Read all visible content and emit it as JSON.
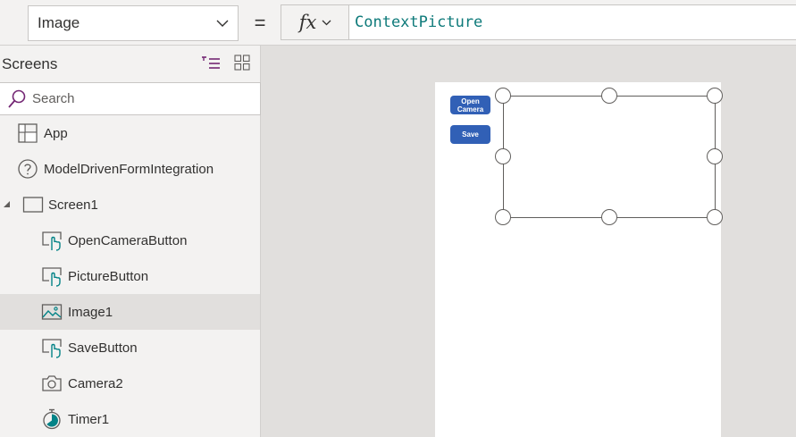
{
  "formula_bar": {
    "property": "Image",
    "equals": "=",
    "fx_label": "fx",
    "formula": "ContextPicture"
  },
  "tree_view": {
    "title": "Screens",
    "search_placeholder": "Search",
    "items": [
      {
        "label": "App",
        "icon": "app-icon",
        "level": 0
      },
      {
        "label": "ModelDrivenFormIntegration",
        "icon": "question-circle-icon",
        "level": 0
      },
      {
        "label": "Screen1",
        "icon": "screen-icon",
        "level": 1,
        "expanded": true
      },
      {
        "label": "OpenCameraButton",
        "icon": "button-control-icon",
        "level": 2
      },
      {
        "label": "PictureButton",
        "icon": "button-control-icon",
        "level": 2
      },
      {
        "label": "Image1",
        "icon": "image-control-icon",
        "level": 2,
        "selected": true
      },
      {
        "label": "SaveButton",
        "icon": "button-control-icon",
        "level": 2
      },
      {
        "label": "Camera2",
        "icon": "camera-icon",
        "level": 2
      },
      {
        "label": "Timer1",
        "icon": "timer-icon",
        "level": 2
      }
    ]
  },
  "canvas": {
    "open_camera_label": "Open Camera",
    "save_label": "Save",
    "button_color": "#3160b6"
  },
  "colors": {
    "panel_bg": "#f3f2f1",
    "canvas_bg": "#e1dfdd",
    "selected_bg": "#e1dfdd",
    "formula_text": "#0e7a7a",
    "accent_teal": "#038387",
    "accent_purple": "#742774"
  }
}
